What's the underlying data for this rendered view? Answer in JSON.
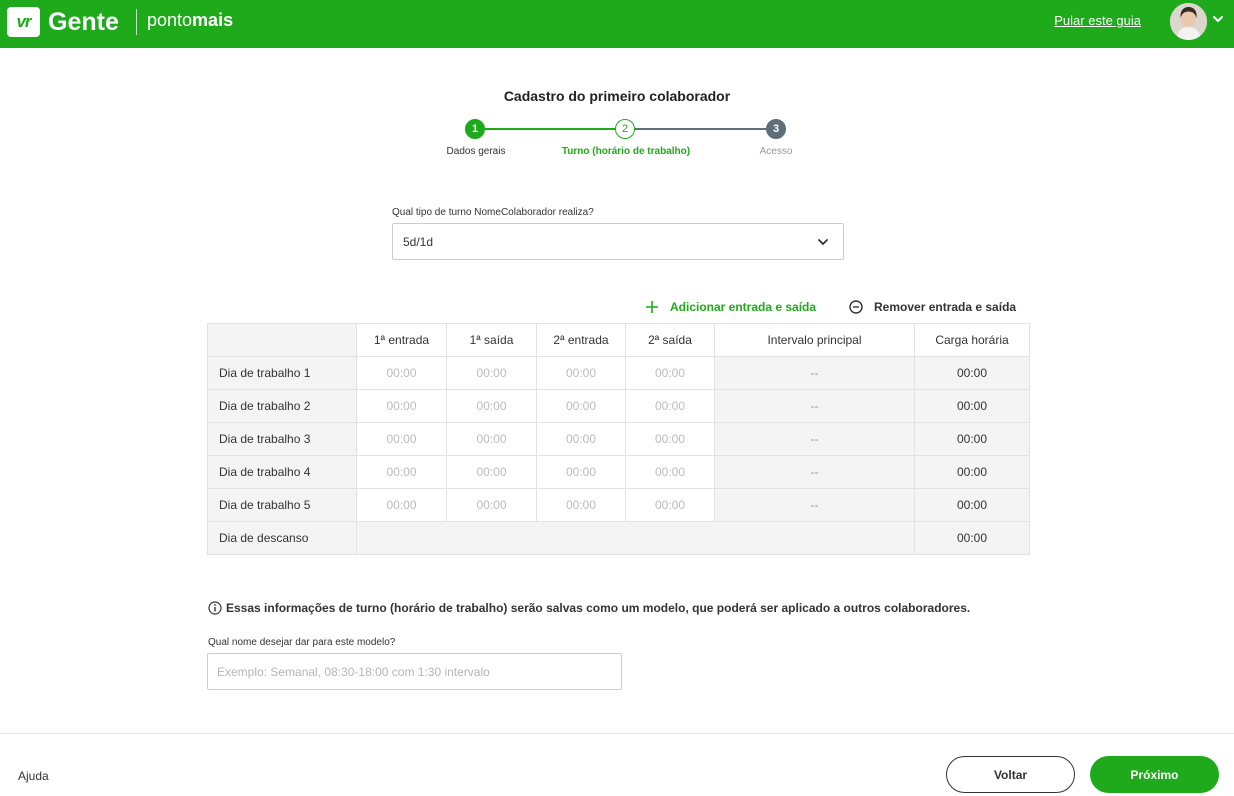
{
  "colors": {
    "brand_green": "#1faa1c",
    "step_inactive": "#5f6f7a",
    "line_inactive": "#5f6f7a"
  },
  "header": {
    "logo_mark": "vr",
    "brand": "Gente",
    "product_prefix": "ponto",
    "product_suffix": "mais",
    "skip_link": "Pular este guia",
    "avatar_icon": "user-avatar",
    "menu_icon": "chevron-down-icon"
  },
  "wizard": {
    "title": "Cadastro do primeiro colaborador",
    "steps": [
      {
        "number": "1",
        "label": "Dados gerais",
        "state": "done"
      },
      {
        "number": "2",
        "label": "Turno (horário de trabalho)",
        "state": "current"
      },
      {
        "number": "3",
        "label": "Acesso",
        "state": "pending"
      }
    ]
  },
  "shift_type": {
    "label": "Qual tipo de turno NomeColaborador realiza?",
    "value": "5d/1d"
  },
  "actions": {
    "add": "Adicionar entrada e saída",
    "remove": "Remover entrada e saída"
  },
  "table": {
    "headers": [
      "",
      "1ª entrada",
      "1ª saída",
      "2ª entrada",
      "2ª saída",
      "Intervalo principal",
      "Carga horária"
    ],
    "rows": [
      {
        "label": "Dia de trabalho 1",
        "times": [
          "00:00",
          "00:00",
          "00:00",
          "00:00"
        ],
        "interval": "--",
        "total": "00:00"
      },
      {
        "label": "Dia de trabalho 2",
        "times": [
          "00:00",
          "00:00",
          "00:00",
          "00:00"
        ],
        "interval": "--",
        "total": "00:00"
      },
      {
        "label": "Dia de trabalho 3",
        "times": [
          "00:00",
          "00:00",
          "00:00",
          "00:00"
        ],
        "interval": "--",
        "total": "00:00"
      },
      {
        "label": "Dia de trabalho 4",
        "times": [
          "00:00",
          "00:00",
          "00:00",
          "00:00"
        ],
        "interval": "--",
        "total": "00:00"
      },
      {
        "label": "Dia de trabalho 5",
        "times": [
          "00:00",
          "00:00",
          "00:00",
          "00:00"
        ],
        "interval": "--",
        "total": "00:00"
      }
    ],
    "rest_row": {
      "label": "Dia de descanso",
      "total": "00:00"
    }
  },
  "info": {
    "text": "Essas informações de turno (horário de trabalho) serão salvas como um modelo, que poderá ser aplicado a outros colaboradores."
  },
  "model_name": {
    "label": "Qual nome desejar dar para este modelo?",
    "placeholder": "Exemplo: Semanal, 08:30-18:00 com 1:30 intervalo",
    "value": ""
  },
  "footer": {
    "help": "Ajuda",
    "back": "Voltar",
    "next": "Próximo"
  }
}
